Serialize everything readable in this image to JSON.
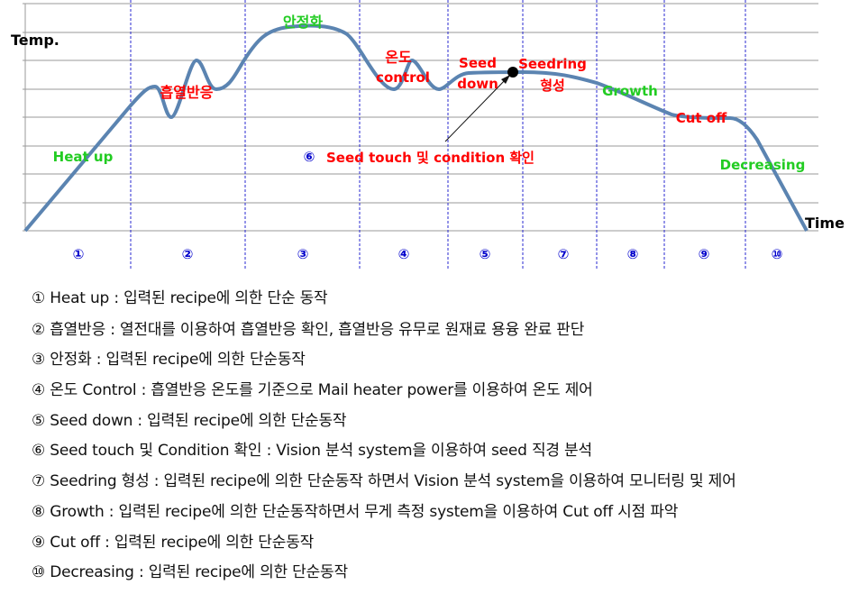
{
  "axes": {
    "y_label": "Temp.",
    "x_label": "Time"
  },
  "phase_numbers": [
    "①",
    "②",
    "③",
    "④",
    "⑤",
    "⑦",
    "⑧",
    "⑨",
    "⑩"
  ],
  "curve_labels": {
    "heat_up": "Heat up",
    "exotherm": "흡열반응",
    "stabilize": "안정화",
    "temp_control_1": "온도",
    "temp_control_2": "control",
    "seed_down_1": "Seed",
    "seed_down_2": "down",
    "seedring_1": "Seedring",
    "seedring_2": "형성",
    "growth": "Growth",
    "cut_off": "Cut off",
    "decreasing": "Decreasing",
    "seed_touch_num": "⑥",
    "seed_touch": "Seed touch 및 condition 확인"
  },
  "colors": {
    "curve": "#5b84b1",
    "red": "#ff0000",
    "green": "#22cc22",
    "blue": "#0000cc",
    "grid": "#9a9a9a"
  },
  "descriptions": [
    "① Heat up : 입력된 recipe에 의한 단순 동작",
    "② 흡열반응 : 열전대를 이용하여 흡열반응 확인, 흡열반응 유무로 원재료 용융 완료 판단",
    "③ 안정화 : 입력된 recipe에 의한 단순동작",
    "④ 온도 Control : 흡열반응 온도를 기준으로 Mail heater power를 이용하여 온도 제어",
    "⑤ Seed down : 입력된 recipe에 의한 단순동작",
    "⑥ Seed touch 및 Condition 확인 : Vision 분석 system을 이용하여 seed 직경 분석",
    "⑦ Seedring 형성 : 입력된 recipe에 의한 단순동작 하면서 Vision 분석 system을 이용하여 모니터링 및 제어",
    "⑧ Growth : 입력된 recipe에 의한 단순동작하면서 무게 측정 system을 이용하여 Cut off 시점 파악",
    "⑨ Cut off : 입력된 recipe에 의한 단순동작",
    "⑩ Decreasing : 입력된 recipe에 의한 단순동작"
  ]
}
